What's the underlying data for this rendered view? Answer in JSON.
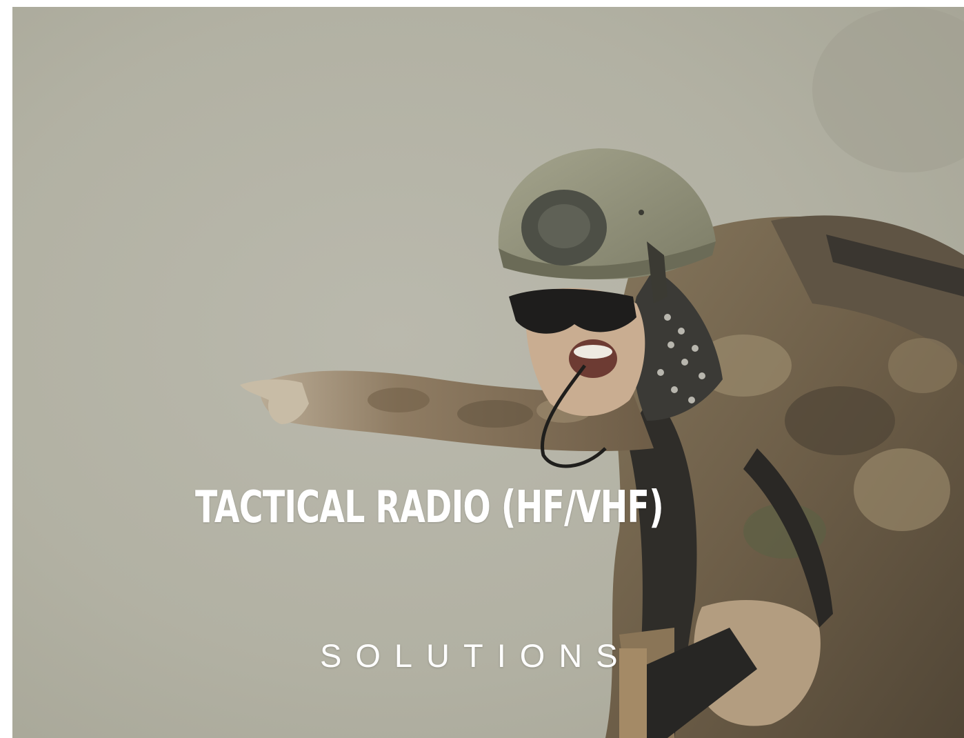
{
  "hero": {
    "title": "TACTICAL RADIO (HF/VHF)",
    "subtitle": "SOLUTIONS"
  },
  "colors": {
    "fog": "#b6b5a8",
    "text": "#ffffff",
    "helmet": "#8e8e78",
    "camo": "#7a6a52",
    "gear": "#2e2c28"
  }
}
